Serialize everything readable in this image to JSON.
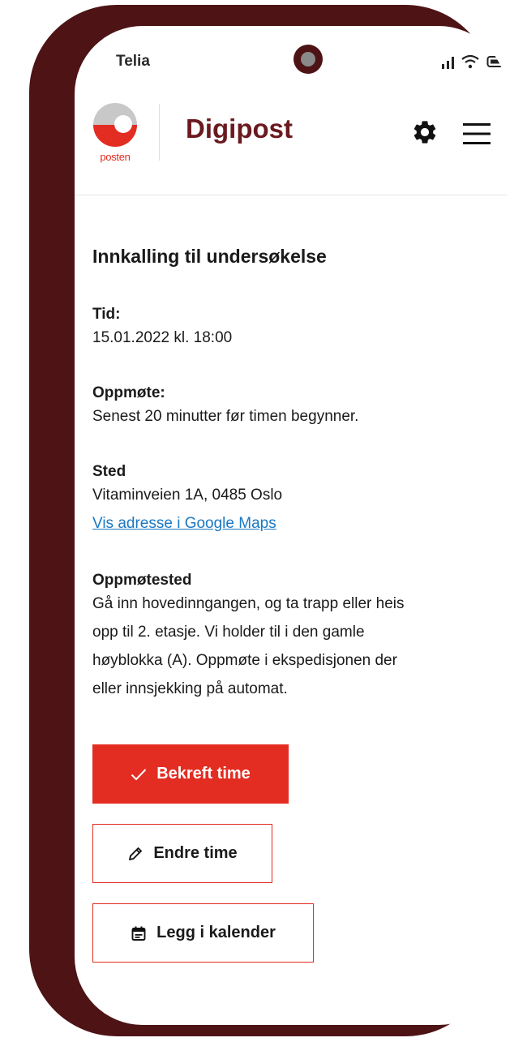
{
  "status_bar": {
    "carrier": "Telia"
  },
  "header": {
    "logo_text": "posten",
    "app_title": "Digipost"
  },
  "document": {
    "title": "Innkalling til undersøkelse",
    "time": {
      "label": "Tid:",
      "value": "15.01.2022 kl. 18:00"
    },
    "attendance": {
      "label": "Oppmøte:",
      "value": "Senest 20 minutter før timen begynner."
    },
    "place": {
      "label": "Sted",
      "address": "Vitaminveien 1A, 0485 Oslo",
      "map_link": "Vis adresse i Google Maps"
    },
    "meeting_point": {
      "label": "Oppmøtested",
      "lines": [
        "Gå inn hovedinngangen, og ta trapp eller heis",
        "opp til 2. etasje. Vi holder til i den gamle",
        "høyblokka (A). Oppmøte i ekspedisjonen der",
        "eller innsjekking på automat."
      ]
    }
  },
  "actions": {
    "confirm": "Bekreft time",
    "edit": "Endre time",
    "calendar": "Legg i kalender"
  },
  "colors": {
    "brand_red": "#e32d22",
    "frame": "#4d1315",
    "title": "#6a1a1f",
    "link": "#1a78c2"
  }
}
